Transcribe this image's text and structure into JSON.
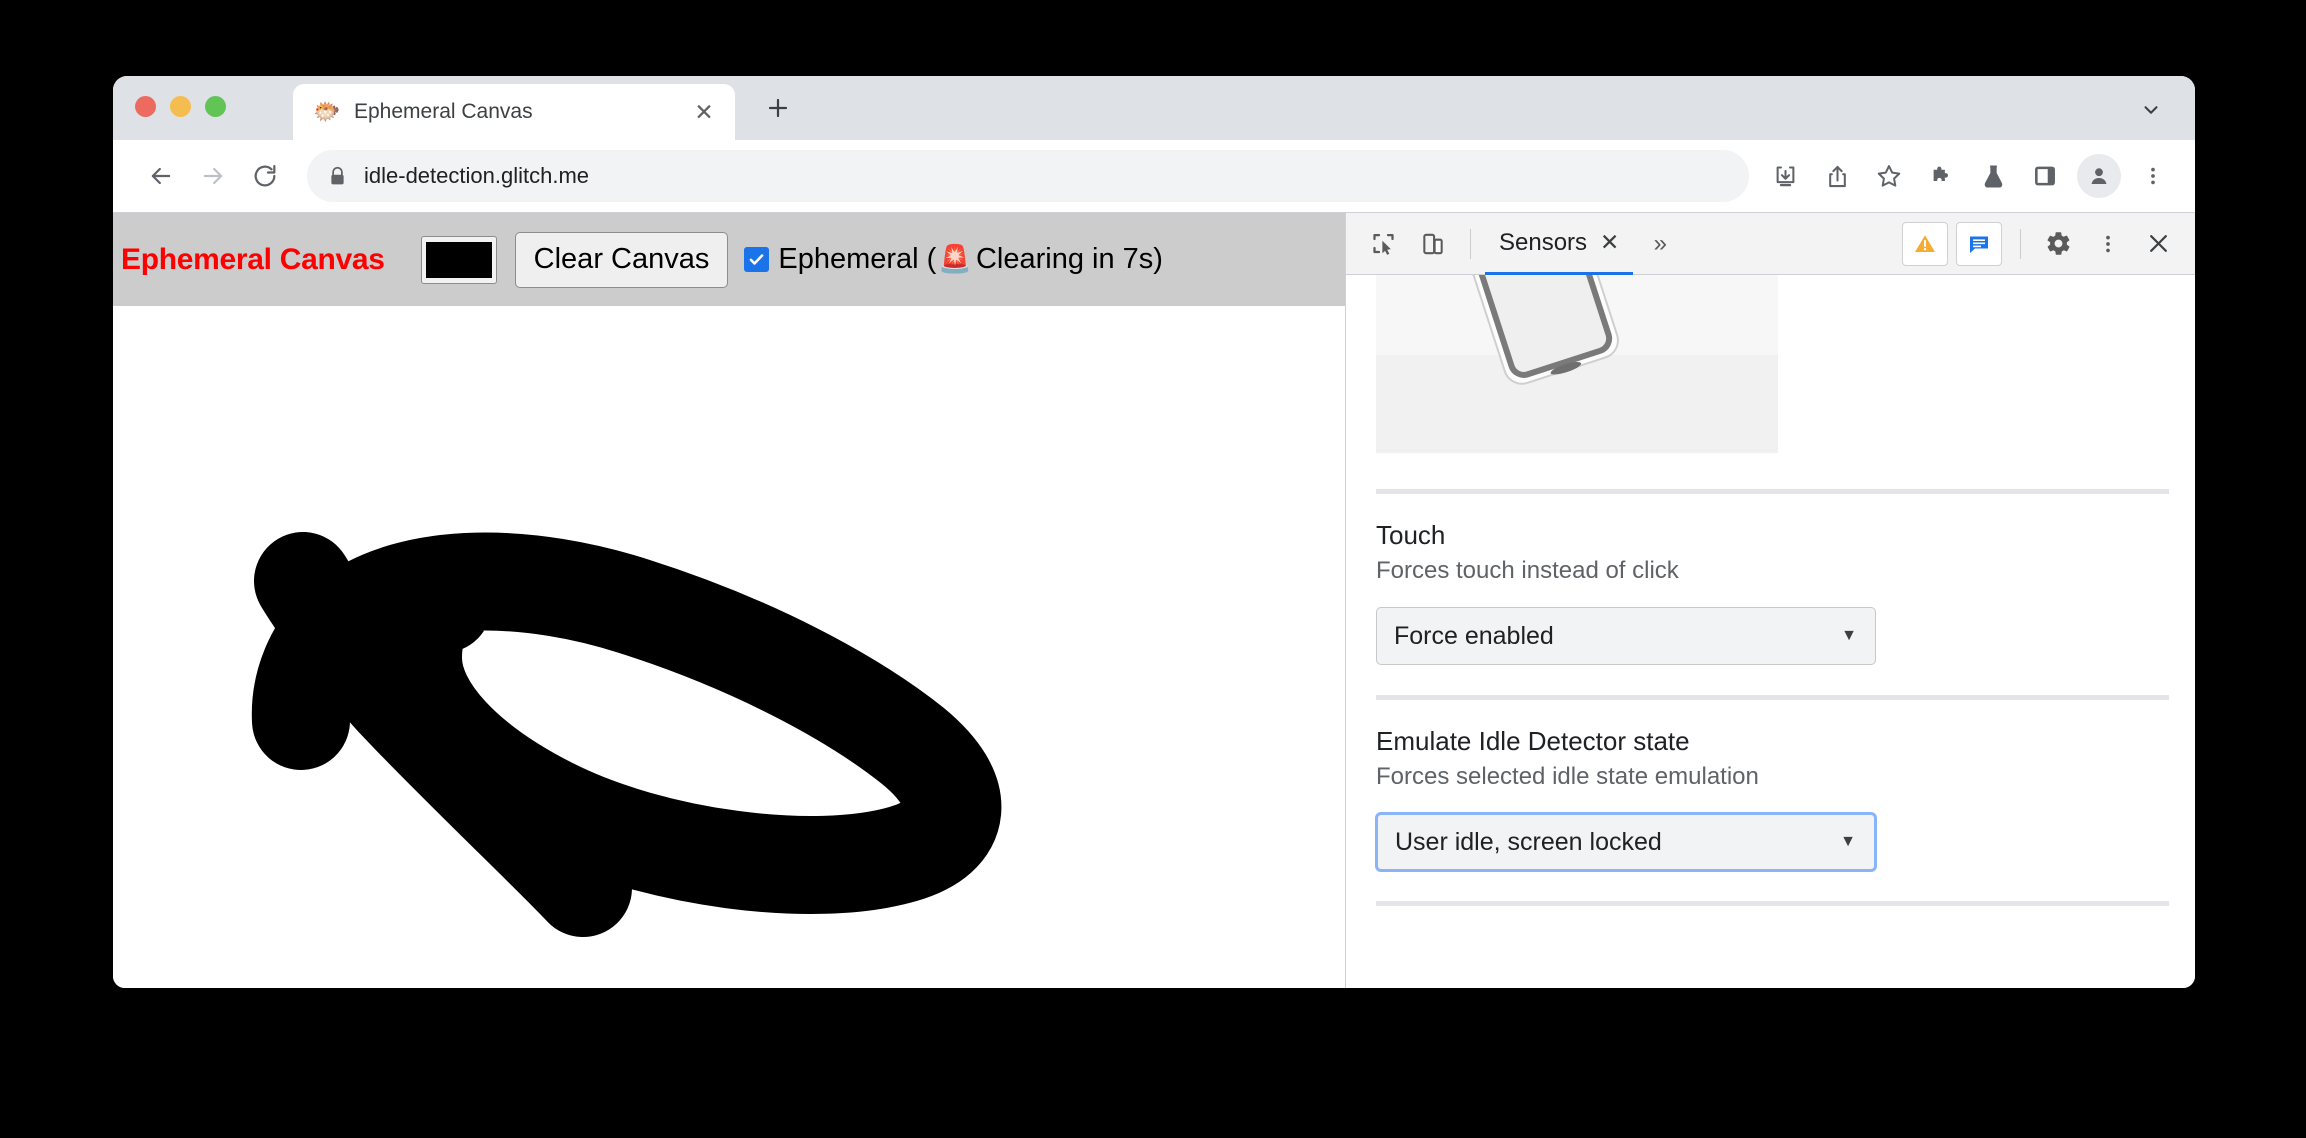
{
  "browser": {
    "tab": {
      "favicon": "blowfish-emoji",
      "favicon_glyph": "🐡",
      "title": "Ephemeral Canvas",
      "close_label": "✕"
    },
    "new_tab_label": "+",
    "tab_search_icon": "chevron-down-icon",
    "omnibox": {
      "security_icon": "lock-icon",
      "url": "idle-detection.glitch.me"
    },
    "nav": {
      "back_icon": "back-arrow-icon",
      "forward_icon": "forward-arrow-icon",
      "reload_icon": "reload-icon"
    },
    "toolbar_icons": [
      "downloads-icon",
      "share-icon",
      "bookmark-star-icon",
      "extensions-puzzle-icon",
      "flask-icon",
      "side-panel-icon",
      "profile-avatar-icon",
      "three-dot-menu-icon"
    ]
  },
  "page": {
    "title": "Ephemeral Canvas",
    "title_color": "#ff0000",
    "color_picker_value": "#000000",
    "clear_button_label": "Clear Canvas",
    "ephemeral_checkbox_checked": true,
    "ephemeral_label_before": "Ephemeral (",
    "ephemeral_siren": "🚨",
    "ephemeral_status": "Clearing in 7s)",
    "header_bg": "#cccccc",
    "canvas_stroke_color": "#000000"
  },
  "devtools": {
    "inspect_icon": "inspect-element-icon",
    "device_toggle_icon": "device-toolbar-icon",
    "active_tab": "Sensors",
    "tab_close_label": "✕",
    "more_tabs_label": "»",
    "warning_badge_icon": "warning-triangle-icon",
    "message_badge_icon": "message-bubble-icon",
    "settings_icon": "gear-icon",
    "menu_icon": "three-dot-menu-icon",
    "close_icon": "close-icon",
    "accent_color": "#1a73e8",
    "orientation_image_alt": "device-orientation-phone-illustration",
    "sections": [
      {
        "title": "Touch",
        "description": "Forces touch instead of click",
        "select_value": "Force enabled",
        "focused": false
      },
      {
        "title": "Emulate Idle Detector state",
        "description": "Forces selected idle state emulation",
        "select_value": "User idle, screen locked",
        "focused": true
      }
    ]
  }
}
